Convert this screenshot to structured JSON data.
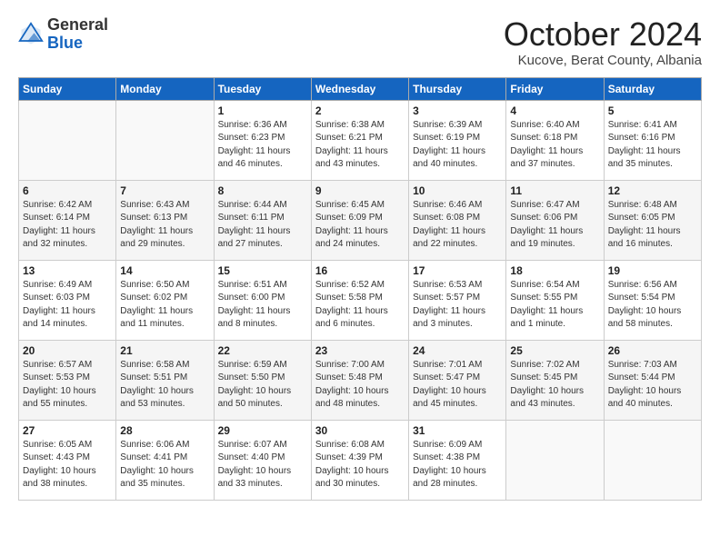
{
  "header": {
    "logo_general": "General",
    "logo_blue": "Blue",
    "month_title": "October 2024",
    "location": "Kucove, Berat County, Albania"
  },
  "weekdays": [
    "Sunday",
    "Monday",
    "Tuesday",
    "Wednesday",
    "Thursday",
    "Friday",
    "Saturday"
  ],
  "weeks": [
    [
      {
        "day": "",
        "content": ""
      },
      {
        "day": "",
        "content": ""
      },
      {
        "day": "1",
        "content": "Sunrise: 6:36 AM\nSunset: 6:23 PM\nDaylight: 11 hours and 46 minutes."
      },
      {
        "day": "2",
        "content": "Sunrise: 6:38 AM\nSunset: 6:21 PM\nDaylight: 11 hours and 43 minutes."
      },
      {
        "day": "3",
        "content": "Sunrise: 6:39 AM\nSunset: 6:19 PM\nDaylight: 11 hours and 40 minutes."
      },
      {
        "day": "4",
        "content": "Sunrise: 6:40 AM\nSunset: 6:18 PM\nDaylight: 11 hours and 37 minutes."
      },
      {
        "day": "5",
        "content": "Sunrise: 6:41 AM\nSunset: 6:16 PM\nDaylight: 11 hours and 35 minutes."
      }
    ],
    [
      {
        "day": "6",
        "content": "Sunrise: 6:42 AM\nSunset: 6:14 PM\nDaylight: 11 hours and 32 minutes."
      },
      {
        "day": "7",
        "content": "Sunrise: 6:43 AM\nSunset: 6:13 PM\nDaylight: 11 hours and 29 minutes."
      },
      {
        "day": "8",
        "content": "Sunrise: 6:44 AM\nSunset: 6:11 PM\nDaylight: 11 hours and 27 minutes."
      },
      {
        "day": "9",
        "content": "Sunrise: 6:45 AM\nSunset: 6:09 PM\nDaylight: 11 hours and 24 minutes."
      },
      {
        "day": "10",
        "content": "Sunrise: 6:46 AM\nSunset: 6:08 PM\nDaylight: 11 hours and 22 minutes."
      },
      {
        "day": "11",
        "content": "Sunrise: 6:47 AM\nSunset: 6:06 PM\nDaylight: 11 hours and 19 minutes."
      },
      {
        "day": "12",
        "content": "Sunrise: 6:48 AM\nSunset: 6:05 PM\nDaylight: 11 hours and 16 minutes."
      }
    ],
    [
      {
        "day": "13",
        "content": "Sunrise: 6:49 AM\nSunset: 6:03 PM\nDaylight: 11 hours and 14 minutes."
      },
      {
        "day": "14",
        "content": "Sunrise: 6:50 AM\nSunset: 6:02 PM\nDaylight: 11 hours and 11 minutes."
      },
      {
        "day": "15",
        "content": "Sunrise: 6:51 AM\nSunset: 6:00 PM\nDaylight: 11 hours and 8 minutes."
      },
      {
        "day": "16",
        "content": "Sunrise: 6:52 AM\nSunset: 5:58 PM\nDaylight: 11 hours and 6 minutes."
      },
      {
        "day": "17",
        "content": "Sunrise: 6:53 AM\nSunset: 5:57 PM\nDaylight: 11 hours and 3 minutes."
      },
      {
        "day": "18",
        "content": "Sunrise: 6:54 AM\nSunset: 5:55 PM\nDaylight: 11 hours and 1 minute."
      },
      {
        "day": "19",
        "content": "Sunrise: 6:56 AM\nSunset: 5:54 PM\nDaylight: 10 hours and 58 minutes."
      }
    ],
    [
      {
        "day": "20",
        "content": "Sunrise: 6:57 AM\nSunset: 5:53 PM\nDaylight: 10 hours and 55 minutes."
      },
      {
        "day": "21",
        "content": "Sunrise: 6:58 AM\nSunset: 5:51 PM\nDaylight: 10 hours and 53 minutes."
      },
      {
        "day": "22",
        "content": "Sunrise: 6:59 AM\nSunset: 5:50 PM\nDaylight: 10 hours and 50 minutes."
      },
      {
        "day": "23",
        "content": "Sunrise: 7:00 AM\nSunset: 5:48 PM\nDaylight: 10 hours and 48 minutes."
      },
      {
        "day": "24",
        "content": "Sunrise: 7:01 AM\nSunset: 5:47 PM\nDaylight: 10 hours and 45 minutes."
      },
      {
        "day": "25",
        "content": "Sunrise: 7:02 AM\nSunset: 5:45 PM\nDaylight: 10 hours and 43 minutes."
      },
      {
        "day": "26",
        "content": "Sunrise: 7:03 AM\nSunset: 5:44 PM\nDaylight: 10 hours and 40 minutes."
      }
    ],
    [
      {
        "day": "27",
        "content": "Sunrise: 6:05 AM\nSunset: 4:43 PM\nDaylight: 10 hours and 38 minutes."
      },
      {
        "day": "28",
        "content": "Sunrise: 6:06 AM\nSunset: 4:41 PM\nDaylight: 10 hours and 35 minutes."
      },
      {
        "day": "29",
        "content": "Sunrise: 6:07 AM\nSunset: 4:40 PM\nDaylight: 10 hours and 33 minutes."
      },
      {
        "day": "30",
        "content": "Sunrise: 6:08 AM\nSunset: 4:39 PM\nDaylight: 10 hours and 30 minutes."
      },
      {
        "day": "31",
        "content": "Sunrise: 6:09 AM\nSunset: 4:38 PM\nDaylight: 10 hours and 28 minutes."
      },
      {
        "day": "",
        "content": ""
      },
      {
        "day": "",
        "content": ""
      }
    ]
  ]
}
